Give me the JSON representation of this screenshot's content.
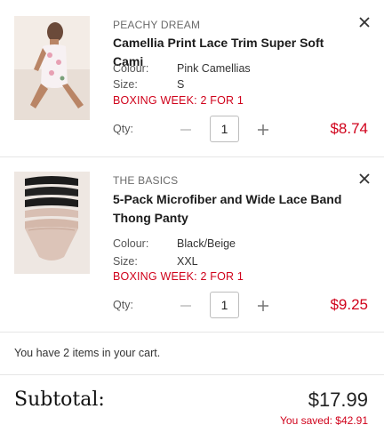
{
  "cart": {
    "items": [
      {
        "brand": "PEACHY DREAM",
        "title": "Camellia Print Lace Trim Super Soft Cami",
        "colour_label": "Colour:",
        "colour": "Pink Camellias",
        "size_label": "Size:",
        "size": "S",
        "promo": "BOXING WEEK: 2 FOR 1",
        "qty_label": "Qty:",
        "qty": "1",
        "price": "$8.74",
        "image_alt": "woman-in-floral-cami"
      },
      {
        "brand": "THE BASICS",
        "title": "5-Pack Microfiber and Wide Lace Band Thong Panty",
        "colour_label": "Colour:",
        "colour": "Black/Beige",
        "size_label": "Size:",
        "size": "XXL",
        "promo": "BOXING WEEK: 2 FOR 1",
        "qty_label": "Qty:",
        "qty": "1",
        "price": "$9.25",
        "image_alt": "stack-of-thong-panties"
      }
    ],
    "item_count_text": "You have 2 items in your cart.",
    "subtotal_label": "Subtotal:",
    "subtotal_value": "$17.99",
    "saved_text": "You saved: $42.91"
  },
  "icons": {
    "close": "close-icon",
    "minus": "minus-icon",
    "plus": "plus-icon"
  },
  "colors": {
    "accent_red": "#d0021b",
    "text_dark": "#1b1b1b",
    "muted": "#6b6b6b",
    "border": "#e6e6e6"
  }
}
